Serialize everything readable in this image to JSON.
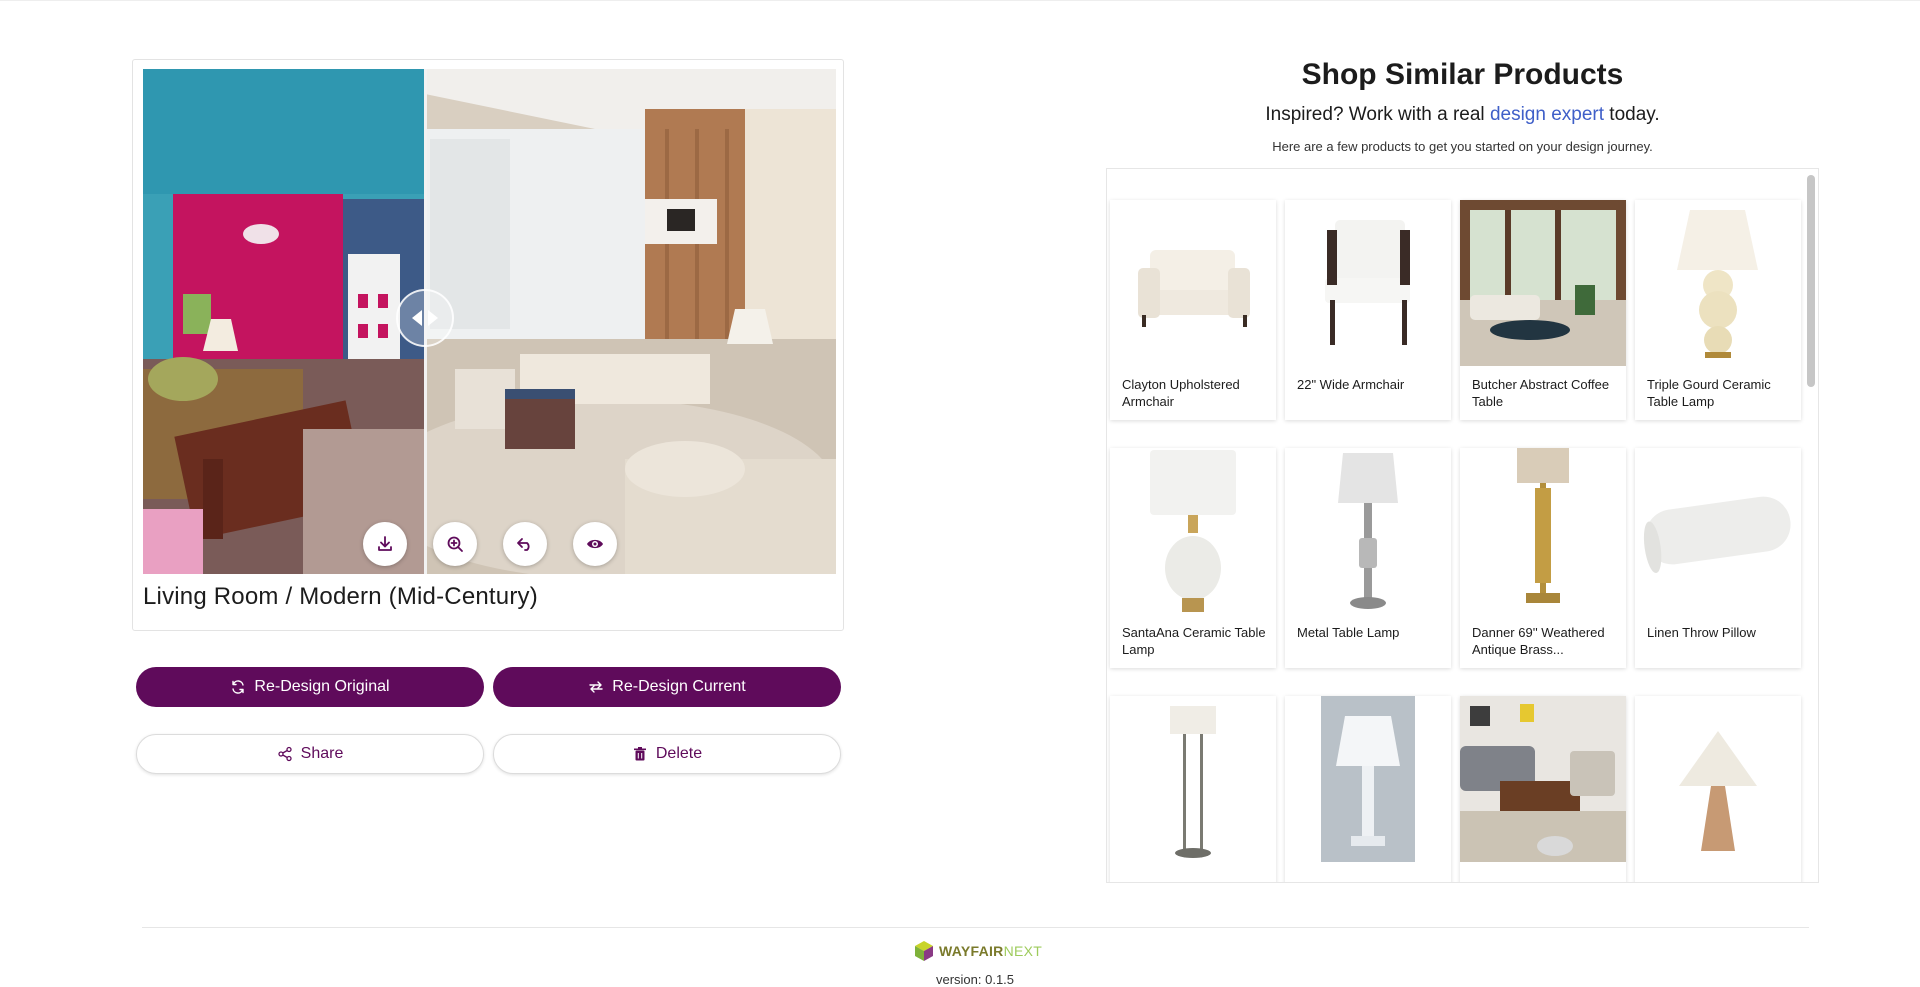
{
  "compare": {
    "room_title": "Living Room / Modern (Mid-Century)",
    "tools": [
      "download-icon",
      "zoom-in-icon",
      "undo-icon",
      "eye-icon"
    ]
  },
  "actions": {
    "redesign_original": "Re-Design Original",
    "redesign_current": "Re-Design Current",
    "share": "Share",
    "delete": "Delete"
  },
  "shop": {
    "title": "Shop Similar Products",
    "subtitle_prefix": "Inspired? Work with a real",
    "subtitle_link": "design expert",
    "subtitle_suffix": "today.",
    "note": "Here are a few products to get you started on your design journey.",
    "products": [
      {
        "name": "Clayton Upholstered Armchair"
      },
      {
        "name": "22\" Wide Armchair"
      },
      {
        "name": "Butcher Abstract Coffee Table"
      },
      {
        "name": "Triple Gourd Ceramic Table Lamp"
      },
      {
        "name": "SantaAna Ceramic Table Lamp"
      },
      {
        "name": "Metal Table Lamp"
      },
      {
        "name": "Danner 69'' Weathered Antique Brass..."
      },
      {
        "name": "Linen Throw Pillow"
      },
      {
        "name": ""
      },
      {
        "name": ""
      },
      {
        "name": ""
      },
      {
        "name": ""
      }
    ]
  },
  "footer": {
    "logo_wayfair": "WAYFAIR",
    "logo_next": "NEXT",
    "version": "version: 0.1.5"
  },
  "colors": {
    "primary": "#5f0b5b",
    "link": "#3f5fc8"
  }
}
